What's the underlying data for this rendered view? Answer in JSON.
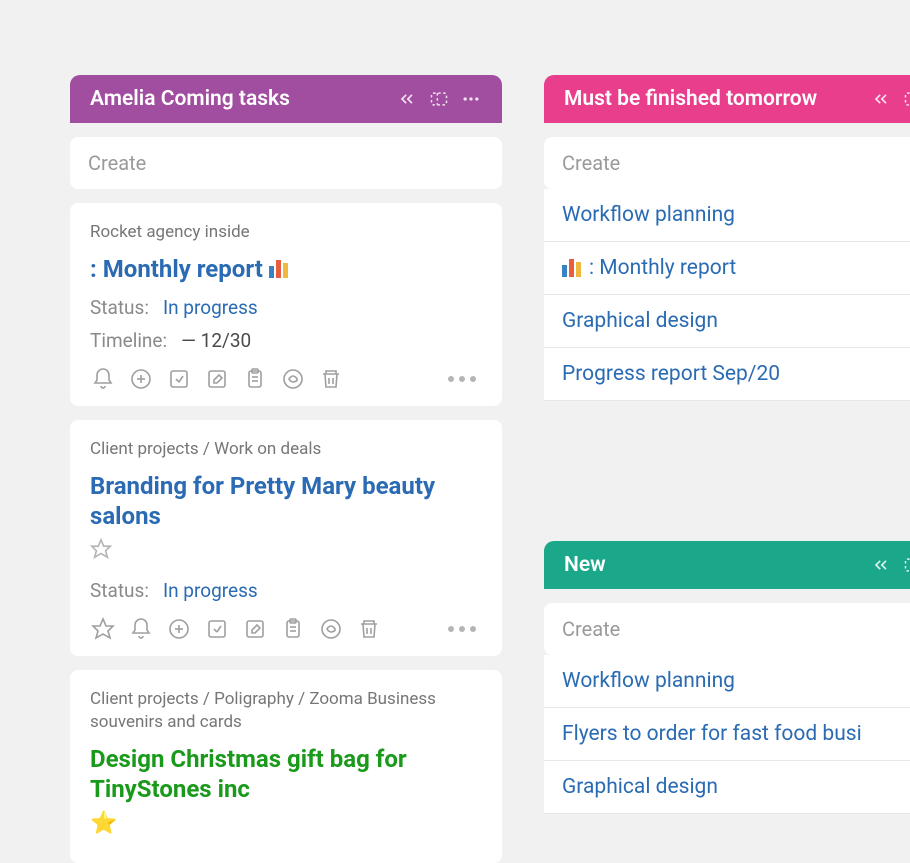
{
  "columns": [
    {
      "title": "Amelia Coming tasks",
      "accent": "purple",
      "create_label": "Create",
      "cards": [
        {
          "breadcrumb": "Rocket agency inside",
          "title_prefix": ": ",
          "title": "Monthly report",
          "has_chart_icon": true,
          "title_color": "blue",
          "status_label": "Status:",
          "status_value": "In progress",
          "timeline_label": "Timeline:",
          "timeline_value": "— 12/30",
          "toolbar": [
            "bell",
            "plus",
            "send",
            "edit",
            "clipboard",
            "sync",
            "trash"
          ]
        },
        {
          "breadcrumb": "Client projects / Work on deals",
          "title": "Branding for Pretty Mary beauty salons",
          "has_star_outline": true,
          "title_color": "blue",
          "status_label": "Status:",
          "status_value": "In progress",
          "toolbar": [
            "star",
            "bell",
            "plus",
            "send",
            "edit",
            "clipboard",
            "sync",
            "trash"
          ]
        },
        {
          "breadcrumb": "Client projects / Poligraphy / Zooma Business souvenirs and cards",
          "title": "Design Christmas gift bag for TinyStones inc",
          "has_star_filled": true,
          "title_color": "green"
        }
      ]
    },
    {
      "title": "Must be finished tomorrow",
      "accent": "pink",
      "create_label": "Create",
      "items": [
        {
          "label": "Workflow planning"
        },
        {
          "label": ": Monthly report",
          "has_chart_icon": true
        },
        {
          "label": "Graphical design"
        },
        {
          "label": "Progress report Sep/20"
        }
      ]
    },
    {
      "title": "New",
      "accent": "teal",
      "create_label": "Create",
      "items": [
        {
          "label": "Workflow planning"
        },
        {
          "label": "Flyers to order for fast food busi"
        },
        {
          "label": "Graphical design"
        }
      ]
    }
  ]
}
